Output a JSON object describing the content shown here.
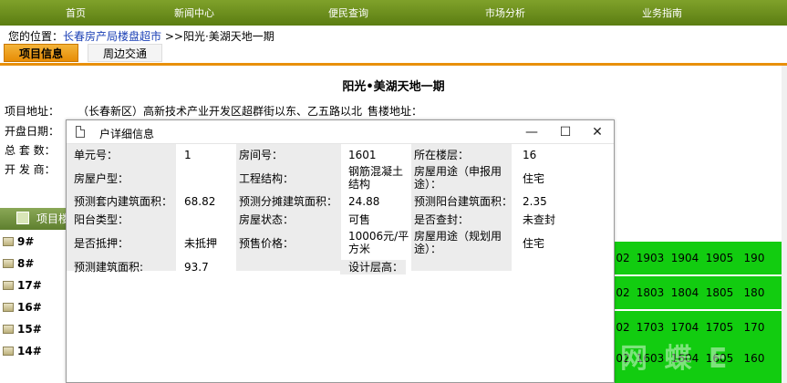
{
  "nav": [
    "首页",
    "新闻中心",
    "便民查询",
    "市场分析",
    "业务指南"
  ],
  "breadcrumb": {
    "prefix": "您的位置：",
    "link": "长春房产局楼盘超市",
    "separator": " >>",
    "current": "阳光·美湖天地一期"
  },
  "tabs": [
    "项目信息",
    "周边交通"
  ],
  "project": {
    "title": "阳光•美湖天地一期",
    "address_label": "项目地址：",
    "address_value": "（长春新区）高新技术产业开发区超群街以东、乙五路以北",
    "sales_label": "售楼地址：",
    "open_label": "开盘日期：",
    "total_label": "总 套 数：",
    "dev_label": "开 发 商："
  },
  "section": {
    "label": "项目楼"
  },
  "buildings": [
    "9#",
    "8#",
    "17#",
    "16#",
    "15#",
    "14#"
  ],
  "grid": [
    [
      "02",
      "1903",
      "1904",
      "1905",
      "190"
    ],
    [
      "02",
      "1803",
      "1804",
      "1805",
      "180"
    ],
    [
      "02",
      "1703",
      "1704",
      "1705",
      "170"
    ],
    [
      "02",
      "1603",
      "1604",
      "1605",
      "160"
    ]
  ],
  "modal": {
    "title": "户详细信息",
    "rows": [
      [
        "单元号：",
        "1",
        "房间号：",
        "1601",
        "所在楼层：",
        "16"
      ],
      [
        "房屋户型：",
        "",
        "工程结构：",
        "钢筋混凝土结构",
        "房屋用途（申报用途）：",
        "住宅"
      ],
      [
        "预测套内建筑面积：",
        "68.82",
        "预测分摊建筑面积：",
        "24.88",
        "预测阳台建筑面积：",
        "2.35"
      ],
      [
        "阳台类型：",
        "",
        "房屋状态：",
        "可售",
        "是否查封：",
        "未查封"
      ],
      [
        "是否抵押：",
        "未抵押",
        "预售价格：",
        "10006元/平方米",
        "房屋用途（规划用途）：",
        "住宅"
      ],
      [
        "预测建筑面积:",
        "93.7",
        "",
        "",
        "设计层高：",
        ""
      ]
    ]
  },
  "window_buttons": {
    "minimize": "—",
    "maximize": "☐",
    "close": "✕"
  },
  "watermark": "网 蝶 E"
}
